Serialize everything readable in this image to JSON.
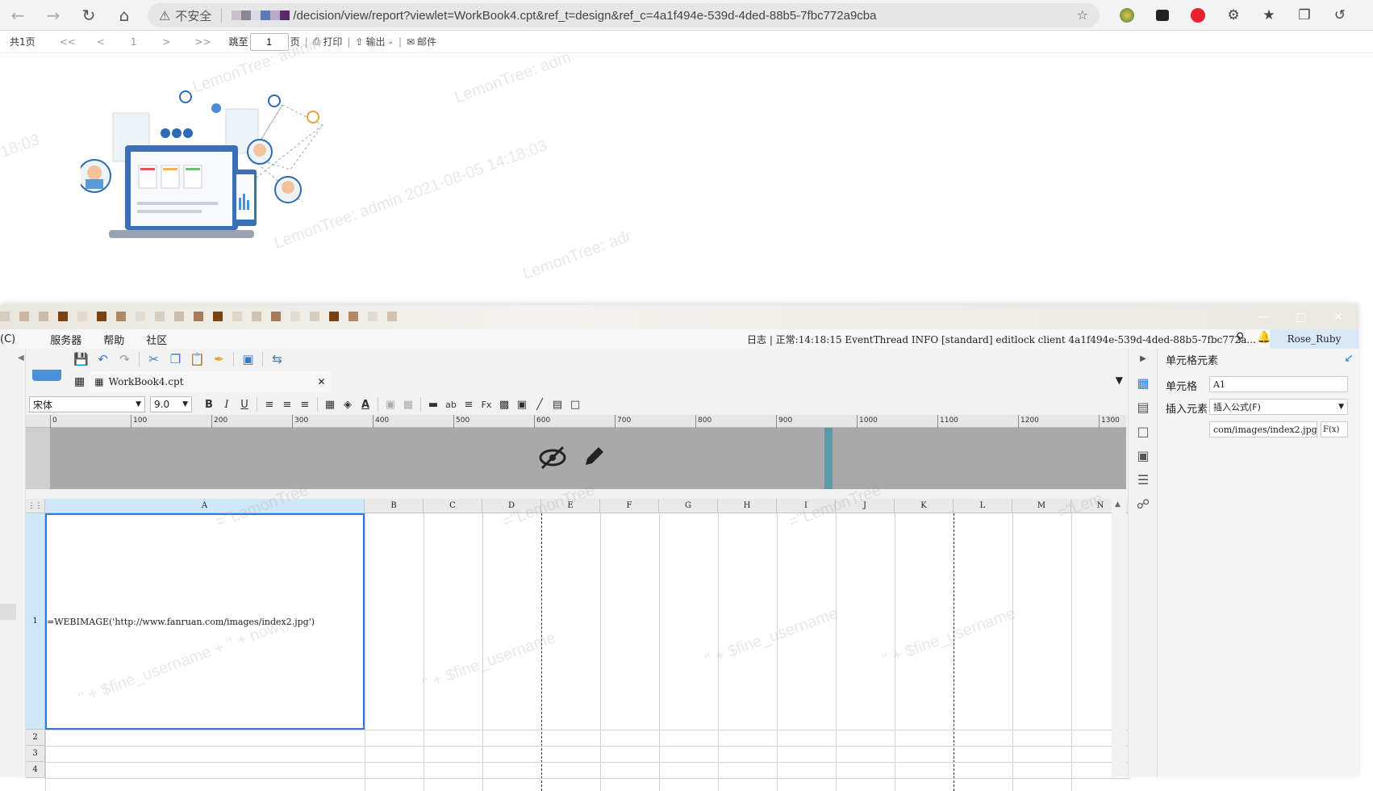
{
  "browser": {
    "security_label": "不安全",
    "url": "/decision/view/report?viewlet=WorkBook4.cpt&ref_t=design&ref_c=4a1f494e-539d-4ded-88b5-7fbc772a9cba"
  },
  "report_toolbar": {
    "total_pages": "共1页",
    "first": "<<",
    "prev": "<",
    "current": "1",
    "next": ">",
    "last": ">>",
    "jump_label": "跳至",
    "jump_value": "1",
    "page_unit": "页",
    "print": "打印",
    "export": "输出",
    "mail": "邮件"
  },
  "watermark": {
    "top_1": "LemonTree: admin 2021-08-05 14:18:03",
    "top_2": "LemonTree: admin",
    "top_3": "LemonTree: adr",
    "top_4": "18:03",
    "top_5": "LemonTree: adm",
    "grid_1": "=\"LemonTree",
    "grid_2": "\" + $fine_username + \" + now()",
    "grid_3": "=\"LemonTree: \" + $",
    "grid_4": "\" + $fine_username",
    "grid_5": "=\"Lem"
  },
  "designer": {
    "menu": [
      "(C)",
      "服务器",
      "帮助",
      "社区"
    ],
    "log_text": "日志 | 正常:14:18:15 EventThread INFO [standard] editlock client 4a1f494e-539d-4ded-88b5-7fbc772a...",
    "user": "Rose_Ruby",
    "tab_name": "WorkBook4.cpt",
    "font_name": "宋体",
    "font_size": "9.0",
    "ruler_ticks": [
      "0",
      "100",
      "200",
      "300",
      "400",
      "500",
      "600",
      "700",
      "800",
      "900",
      "1000",
      "1100",
      "1200",
      "1300"
    ],
    "columns": [
      "A",
      "B",
      "C",
      "D",
      "E",
      "F",
      "G",
      "H",
      "I",
      "J",
      "K",
      "L",
      "M",
      "N"
    ],
    "rows": [
      "1",
      "2",
      "3",
      "4"
    ],
    "cell_a1_formula": "=WEBIMAGE('http://www.fanruan.com/images/index2.jpg')",
    "panel": {
      "title": "单元格元素",
      "cell_label": "单元格",
      "cell_value": "A1",
      "insert_label": "插入元素",
      "insert_value": "插入公式(F)",
      "formula_preview": "com/images/index2.jpg')",
      "fx": "F(x)"
    }
  },
  "colors": {
    "accent": "#2c7be5",
    "selected_header": "#cfe8f9",
    "band": "#a8a8a8"
  }
}
